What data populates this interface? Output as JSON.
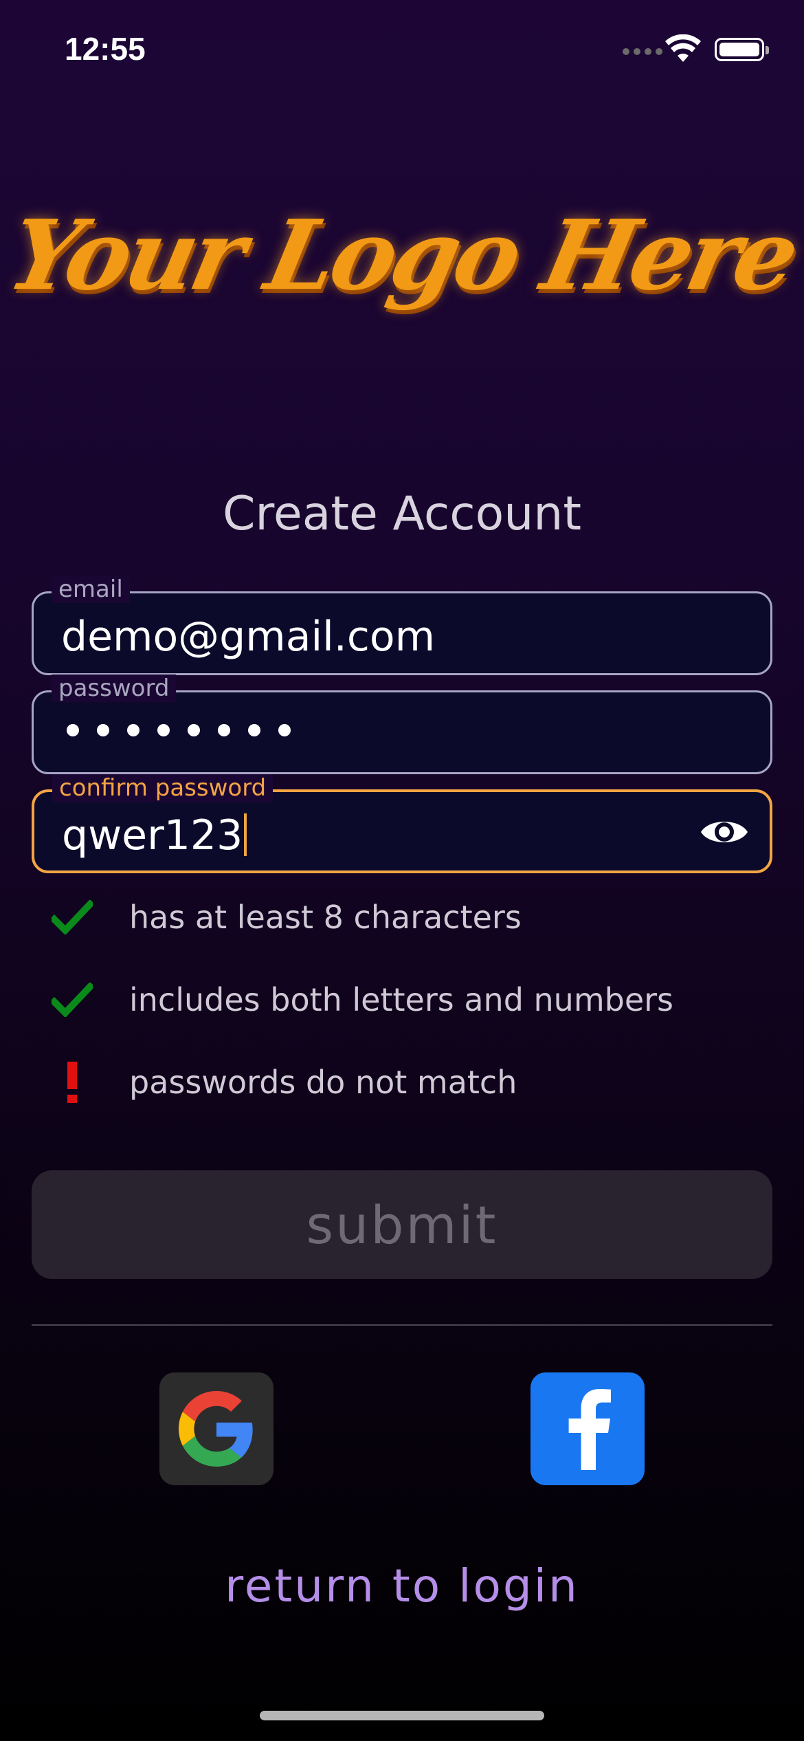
{
  "status_bar": {
    "time": "12:55",
    "icons": [
      "cellular-signal-icon",
      "wifi-icon",
      "battery-icon"
    ]
  },
  "logo": {
    "text": "Your Logo Here"
  },
  "page_title": "Create Account",
  "form": {
    "email": {
      "label": "email",
      "value": "demo@gmail.com"
    },
    "password": {
      "label": "password",
      "masked_length": 8
    },
    "confirm_password": {
      "label": "confirm password",
      "value": "qwer123",
      "focused": true,
      "visibility_icon": "eye-icon"
    }
  },
  "requirements": [
    {
      "text": "has at least 8 characters",
      "status": "met",
      "icon": "check-icon"
    },
    {
      "text": "includes both letters and numbers",
      "status": "met",
      "icon": "check-icon"
    },
    {
      "text": "passwords do not match",
      "status": "error",
      "icon": "exclamation-icon"
    }
  ],
  "submit_label": "submit",
  "social": {
    "google": "google-icon",
    "facebook": "facebook-icon"
  },
  "return_link": "return to login",
  "colors": {
    "accent_focus": "#f3a443",
    "check": "#0a8a1a",
    "error": "#e01010",
    "link": "#b58ee8",
    "facebook_blue": "#1a77f2"
  }
}
